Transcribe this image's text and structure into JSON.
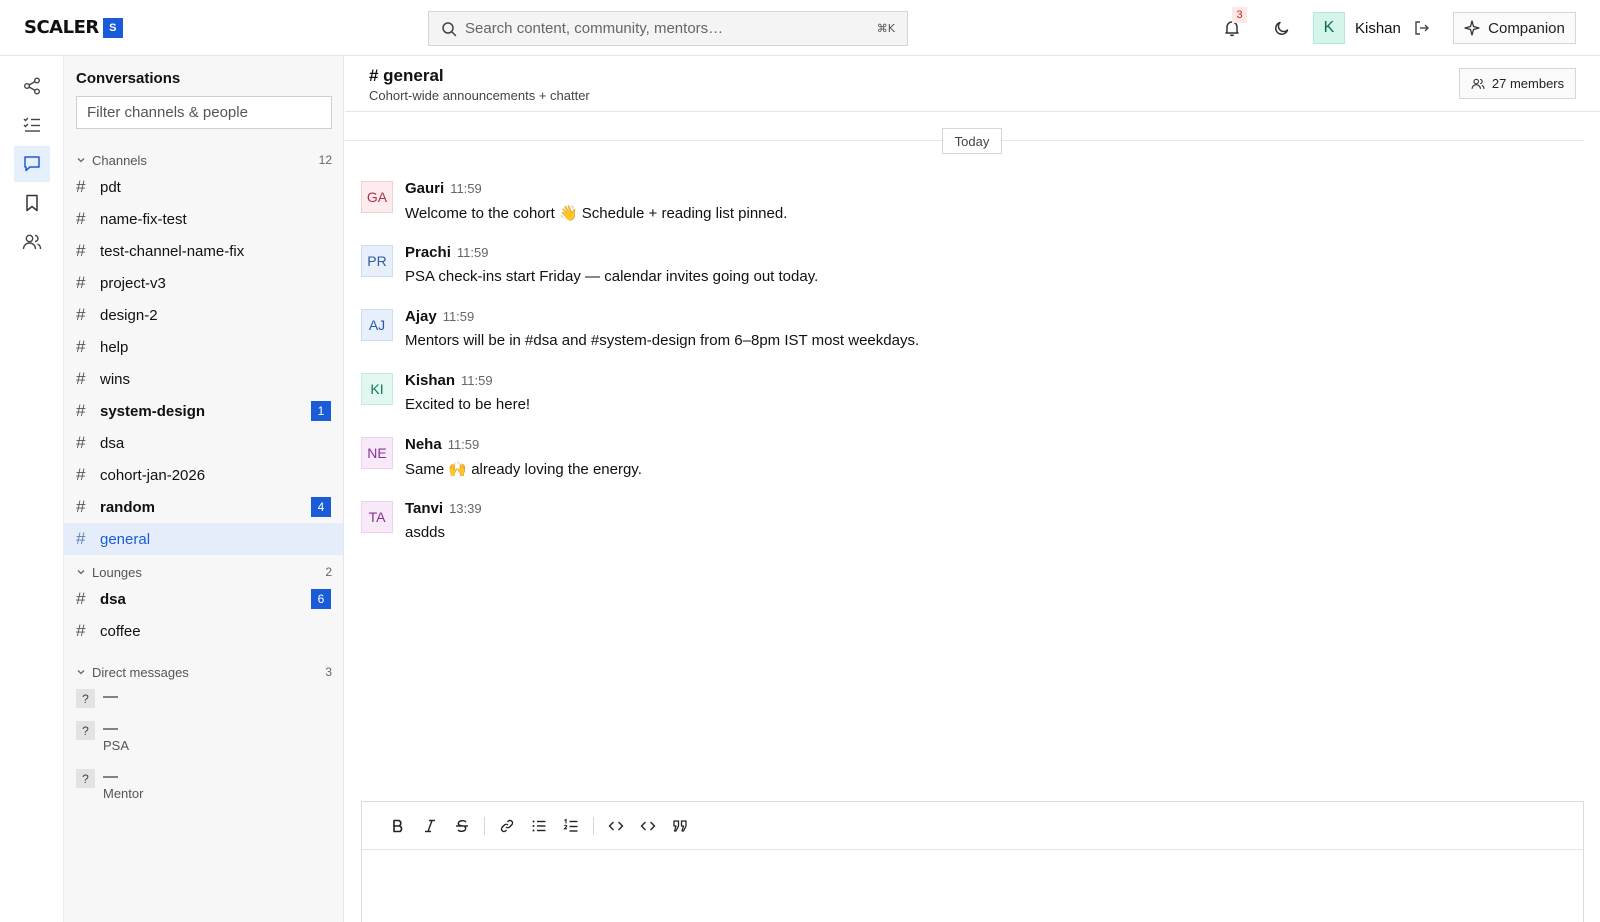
{
  "topbar": {
    "logo_text": "SCALER",
    "logo_mark": "S",
    "search_placeholder": "Search content, community, mentors…",
    "search_shortcut": "⌘K",
    "notifications_count": "3",
    "user_initial": "K",
    "user_name": "Kishan",
    "companion_label": "Companion",
    "icons": [
      "search-icon",
      "bell-icon",
      "moon-icon",
      "logout-icon",
      "sparkle-icon"
    ]
  },
  "rail": {
    "items": [
      {
        "name": "share-icon",
        "active": false
      },
      {
        "name": "checklist-icon",
        "active": false
      },
      {
        "name": "chat-icon",
        "active": true
      },
      {
        "name": "bookmark-icon",
        "active": false
      },
      {
        "name": "users-icon",
        "active": false
      }
    ]
  },
  "sidebar": {
    "title": "Conversations",
    "filter_placeholder": "Filter channels & people",
    "channels": {
      "label": "Channels",
      "count": "12",
      "items": [
        {
          "label": "pdt",
          "badge": "",
          "unread": false,
          "active": false
        },
        {
          "label": "name-fix-test",
          "badge": "",
          "unread": false,
          "active": false
        },
        {
          "label": "test-channel-name-fix",
          "badge": "",
          "unread": false,
          "active": false
        },
        {
          "label": "project-v3",
          "badge": "",
          "unread": false,
          "active": false
        },
        {
          "label": "design-2",
          "badge": "",
          "unread": false,
          "active": false
        },
        {
          "label": "help",
          "badge": "",
          "unread": false,
          "active": false
        },
        {
          "label": "wins",
          "badge": "",
          "unread": false,
          "active": false
        },
        {
          "label": "system-design",
          "badge": "1",
          "unread": true,
          "active": false
        },
        {
          "label": "dsa",
          "badge": "",
          "unread": false,
          "active": false
        },
        {
          "label": "cohort-jan-2026",
          "badge": "",
          "unread": false,
          "active": false
        },
        {
          "label": "random",
          "badge": "4",
          "unread": true,
          "active": false
        },
        {
          "label": "general",
          "badge": "",
          "unread": false,
          "active": true
        }
      ]
    },
    "lounges": {
      "label": "Lounges",
      "count": "2",
      "items": [
        {
          "label": "dsa",
          "badge": "6",
          "unread": true,
          "active": false
        },
        {
          "label": "coffee",
          "badge": "",
          "unread": false,
          "active": false
        }
      ]
    },
    "direct_messages": {
      "label": "Direct messages",
      "count": "3",
      "items": [
        {
          "avatar": "?",
          "name": "—",
          "sub": ""
        },
        {
          "avatar": "?",
          "name": "—",
          "sub": "PSA"
        },
        {
          "avatar": "?",
          "name": "—",
          "sub": "Mentor"
        }
      ]
    }
  },
  "channel": {
    "title": "# general",
    "description": "Cohort-wide announcements + chatter",
    "members_label": "27 members",
    "day_divider": "Today",
    "messages": [
      {
        "initials": "GA",
        "author": "Gauri",
        "time": "11:59",
        "text": "Welcome to the cohort 👋 Schedule + reading list pinned.",
        "bg": "#fdecee",
        "fg": "#b0304a",
        "border": "#f5cdd4"
      },
      {
        "initials": "PR",
        "author": "Prachi",
        "time": "11:59",
        "text": "PSA check-ins start Friday — calendar invites going out today.",
        "bg": "#e7effb",
        "fg": "#2c5aa0",
        "border": "#cfdcf3"
      },
      {
        "initials": "AJ",
        "author": "Ajay",
        "time": "11:59",
        "text": "Mentors will be in #dsa and #system-design from 6–8pm IST most weekdays.",
        "bg": "#e7effb",
        "fg": "#2c5aa0",
        "border": "#cfdcf3"
      },
      {
        "initials": "KI",
        "author": "Kishan",
        "time": "11:59",
        "text": "Excited to be here!",
        "bg": "#e2f7ef",
        "fg": "#137a55",
        "border": "#c3ecdb"
      },
      {
        "initials": "NE",
        "author": "Neha",
        "time": "11:59",
        "text": "Same 🙌 already loving the energy.",
        "bg": "#f7e9f8",
        "fg": "#8a2f95",
        "border": "#ebd2ee"
      },
      {
        "initials": "TA",
        "author": "Tanvi",
        "time": "13:39",
        "text": "asdds",
        "bg": "#f7e9f8",
        "fg": "#8a2f95",
        "border": "#ebd2ee"
      }
    ]
  },
  "composer": {
    "toolbar": [
      "bold-icon",
      "italic-icon",
      "strikethrough-icon",
      "link-icon",
      "bullet-list-icon",
      "numbered-list-icon",
      "inline-code-icon",
      "code-block-icon",
      "quote-icon"
    ]
  }
}
